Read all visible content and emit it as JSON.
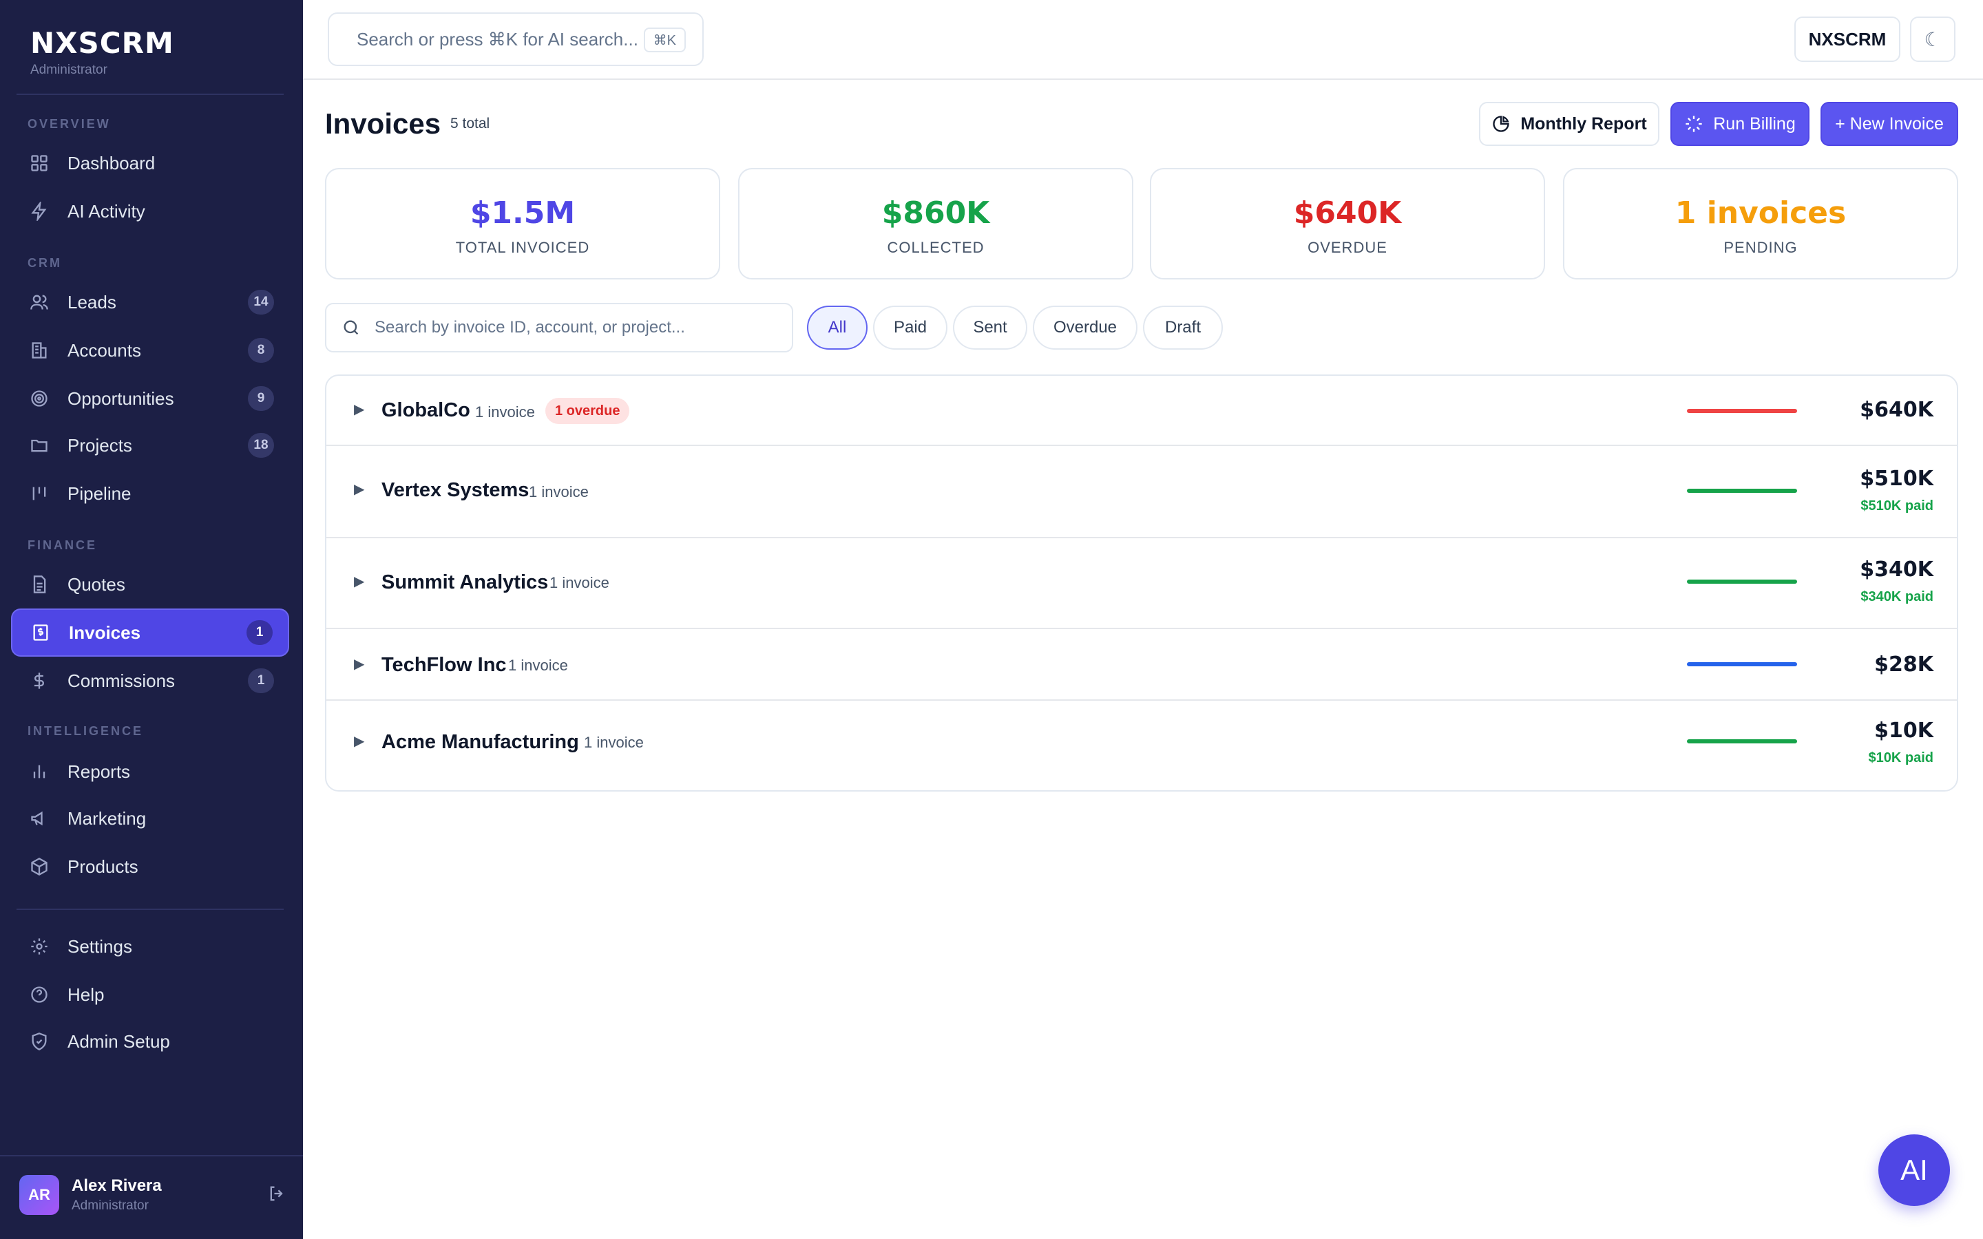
{
  "brand": {
    "name": "NXSCRM",
    "role": "Administrator"
  },
  "sidebar": {
    "sections": {
      "overview": "OVERVIEW",
      "crm": "CRM",
      "finance": "FINANCE",
      "intelligence": "INTELLIGENCE"
    },
    "items": {
      "dashboard": {
        "label": "Dashboard",
        "icon": "grid-icon"
      },
      "ai_activity": {
        "label": "AI Activity",
        "icon": "bolt-icon"
      },
      "leads": {
        "label": "Leads",
        "badge": "14",
        "icon": "users-icon"
      },
      "accounts": {
        "label": "Accounts",
        "badge": "8",
        "icon": "building-icon"
      },
      "opportunities": {
        "label": "Opportunities",
        "badge": "9",
        "icon": "target-icon"
      },
      "projects": {
        "label": "Projects",
        "badge": "18",
        "icon": "folder-icon"
      },
      "pipeline": {
        "label": "Pipeline",
        "icon": "pipeline-icon"
      },
      "quotes": {
        "label": "Quotes",
        "icon": "document-icon"
      },
      "invoices": {
        "label": "Invoices",
        "badge": "1",
        "icon": "invoice-icon",
        "active": true
      },
      "commissions": {
        "label": "Commissions",
        "badge": "1",
        "icon": "dollar-icon"
      },
      "reports": {
        "label": "Reports",
        "icon": "bar-chart-icon"
      },
      "marketing": {
        "label": "Marketing",
        "icon": "megaphone-icon"
      },
      "products": {
        "label": "Products",
        "icon": "box-icon"
      },
      "settings": {
        "label": "Settings",
        "icon": "gear-icon"
      },
      "help": {
        "label": "Help",
        "icon": "help-icon"
      },
      "admin_setup": {
        "label": "Admin Setup",
        "icon": "shield-icon"
      }
    },
    "user": {
      "initials": "AR",
      "name": "Alex Rivera",
      "role": "Administrator"
    }
  },
  "topbar": {
    "search_placeholder": "Search or press ⌘K for AI search...",
    "search_shortcut": "⌘K",
    "brand_button": "NXSCRM",
    "theme_icon": "☾"
  },
  "page": {
    "title": "Invoices",
    "count": "5 total",
    "buttons": {
      "monthly_report": "Monthly Report",
      "run_billing": "Run Billing",
      "new_invoice": "+ New Invoice"
    }
  },
  "stats": {
    "total": {
      "value": "$1.5M",
      "label": "TOTAL INVOICED",
      "color": "#4f46e5"
    },
    "collected": {
      "value": "$860K",
      "label": "COLLECTED",
      "color": "#16a34a"
    },
    "overdue": {
      "value": "$640K",
      "label": "OVERDUE",
      "color": "#dc2626"
    },
    "pending": {
      "value": "1 invoices",
      "label": "PENDING",
      "color": "#f59e0b"
    }
  },
  "filters": {
    "search_placeholder": "Search by invoice ID, account, or project...",
    "chips": {
      "all": "All",
      "paid": "Paid",
      "sent": "Sent",
      "overdue": "Overdue",
      "draft": "Draft"
    },
    "active": "All"
  },
  "accounts": [
    {
      "name": "GlobalCo",
      "count": "1 invoice",
      "overdue": "1 overdue",
      "amount": "$640K",
      "paid": "",
      "bar_color": "#ef4444"
    },
    {
      "name": "Vertex Systems",
      "count": "1 invoice",
      "overdue": "",
      "amount": "$510K",
      "paid": "$510K paid",
      "bar_color": "#16a34a"
    },
    {
      "name": "Summit Analytics",
      "count": "1 invoice",
      "overdue": "",
      "amount": "$340K",
      "paid": "$340K paid",
      "bar_color": "#16a34a"
    },
    {
      "name": "TechFlow Inc",
      "count": "1 invoice",
      "overdue": "",
      "amount": "$28K",
      "paid": "",
      "bar_color": "#2563eb"
    },
    {
      "name": "Acme Manufacturing",
      "count": "1 invoice",
      "overdue": "",
      "amount": "$10K",
      "paid": "$10K paid",
      "bar_color": "#16a34a"
    }
  ],
  "fab": {
    "label": "AI"
  }
}
